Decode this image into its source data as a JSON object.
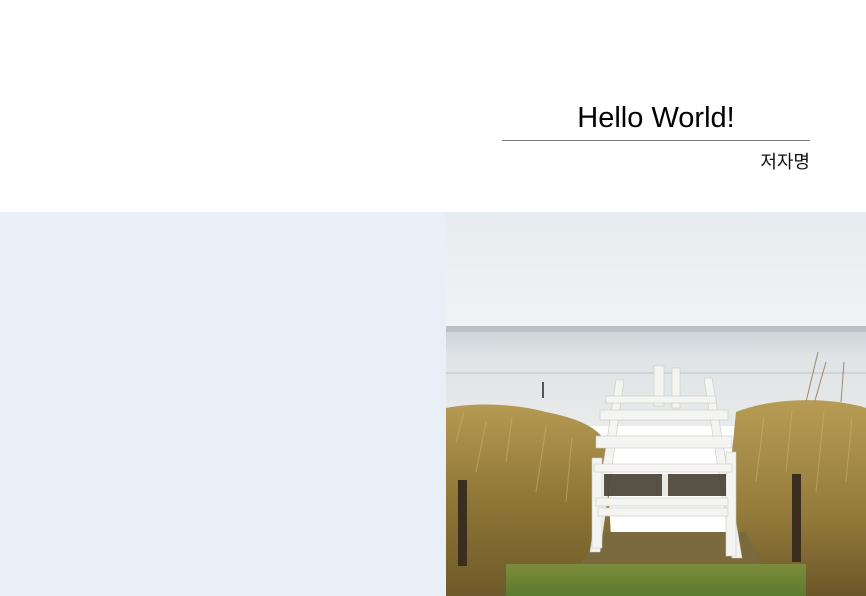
{
  "cover": {
    "title": "Hello World!",
    "author": "저자명"
  },
  "colors": {
    "left_panel": "#e9eff7",
    "title_rule": "#777777"
  },
  "photo": {
    "subject": "white wooden beach stairs between dune grass"
  }
}
